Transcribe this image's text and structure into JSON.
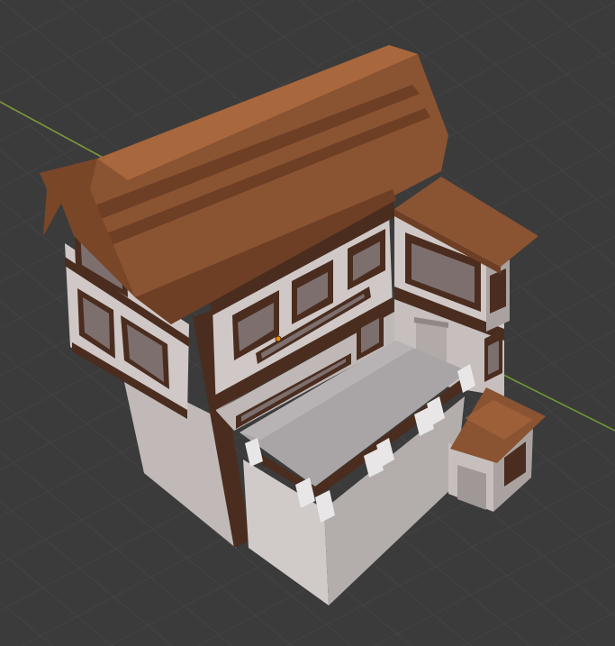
{
  "viewport": {
    "background_color": "#3b3b3b",
    "grid_color": "#474747",
    "x_axis_color": "#7a9a3a",
    "y_axis_color": "#6f9a2e"
  },
  "model": {
    "roof_color": "#8a5332",
    "roof_dark_color": "#6e3f24",
    "roof_highlight_color": "#a8673c",
    "wall_light_color": "#d4cdcb",
    "wall_mid_color": "#b9b2b0",
    "wall_shadow_color": "#8f8886",
    "timber_color": "#4a2d1f",
    "window_glass_color": "#7d6f6d",
    "terrace_floor_color": "#a9a5a6",
    "pillar_color": "#e8e6e6"
  },
  "origin_icon": "origin-point-icon",
  "origin_color": "#f08a00"
}
